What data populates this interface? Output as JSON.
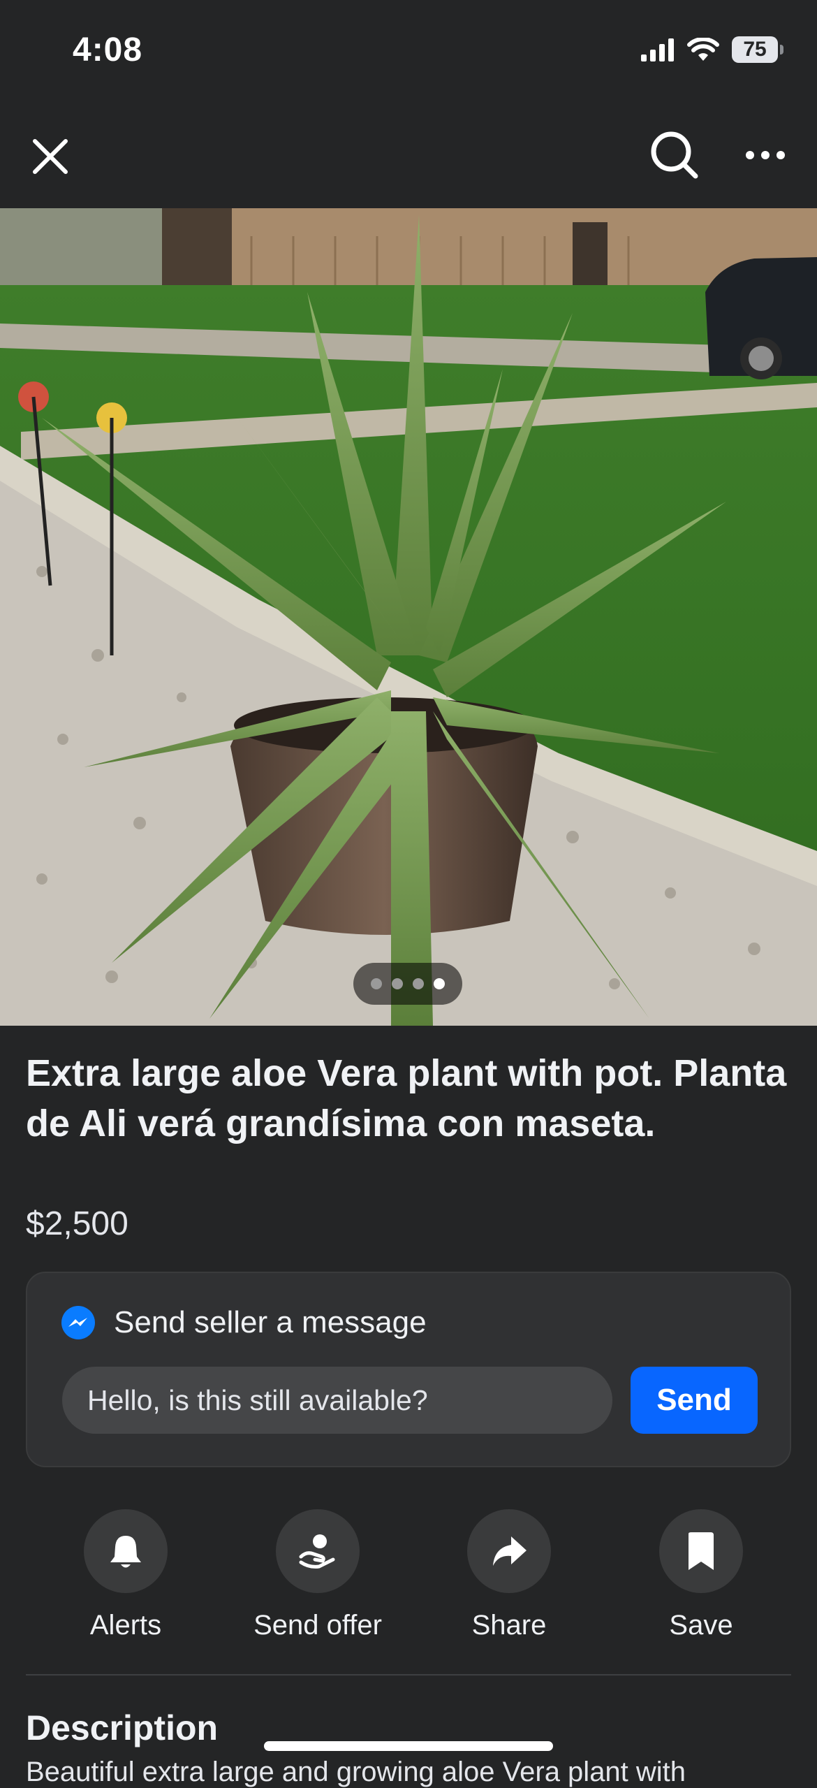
{
  "status_bar": {
    "time": "4:08",
    "battery": "75"
  },
  "top_bar": {
    "close_icon": "close-icon",
    "search_icon": "search-icon",
    "more_icon": "more-horizontal-icon"
  },
  "gallery": {
    "image_count": 4,
    "active_index": 3
  },
  "listing": {
    "title": "Extra large aloe Vera plant with pot. Planta de Ali verá grandísima con maseta.",
    "price": "$2,500"
  },
  "message": {
    "header": "Send seller a message",
    "input_value": "Hello, is this still available?",
    "send_label": "Send"
  },
  "actions": [
    {
      "label": "Alerts",
      "icon": "bell-icon"
    },
    {
      "label": "Send offer",
      "icon": "offer-hand-icon"
    },
    {
      "label": "Share",
      "icon": "share-arrow-icon"
    },
    {
      "label": "Save",
      "icon": "bookmark-icon"
    }
  ],
  "description": {
    "heading": "Description",
    "text": "Beautiful extra large and growing aloe Vera plant with"
  },
  "colors": {
    "background": "#242526",
    "accent": "#0866ff",
    "card": "#303133"
  }
}
